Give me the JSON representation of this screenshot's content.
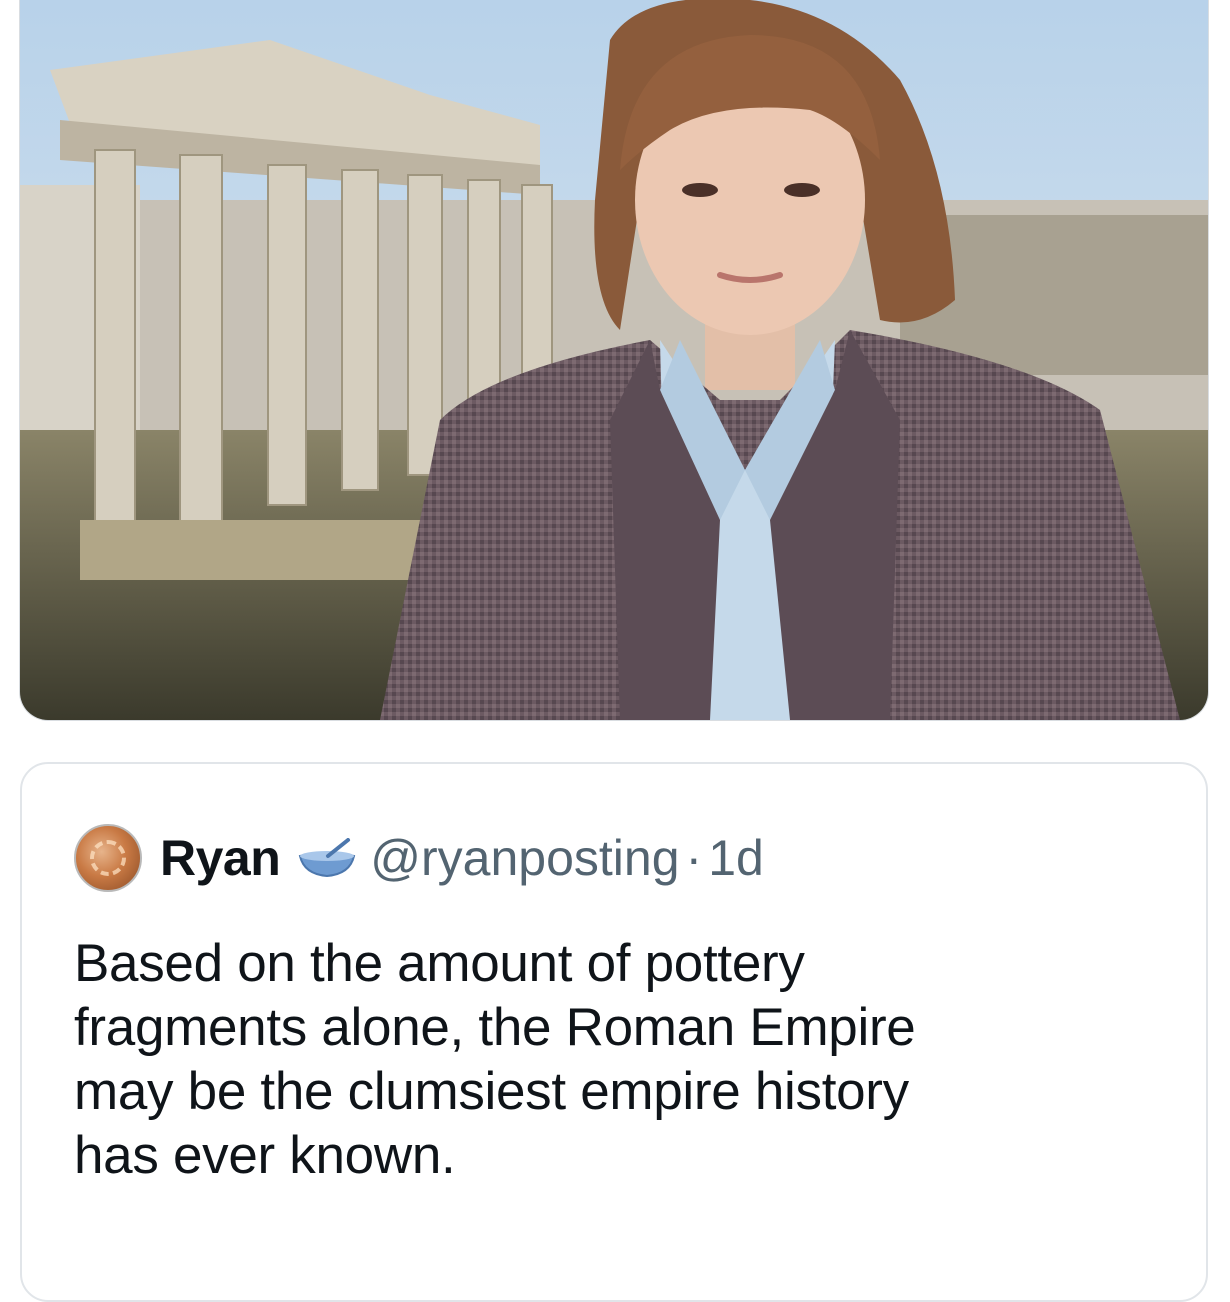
{
  "photo": {
    "subject": "person-standing-in-front-of-roman-ruins",
    "sky_color": "#c9dced",
    "blazer_color": "#6e5a63",
    "shirt_color": "#c5d9ea"
  },
  "tweet": {
    "author": {
      "display_name": "Ryan",
      "badge_icon": "bowl-with-spoon-icon",
      "handle": "@ryanposting",
      "separator": "·",
      "time": "1d"
    },
    "lines": [
      "Based on the amount of pottery",
      "fragments alone, the Roman Empire",
      "may be the clumsiest empire history",
      "has ever known."
    ]
  }
}
